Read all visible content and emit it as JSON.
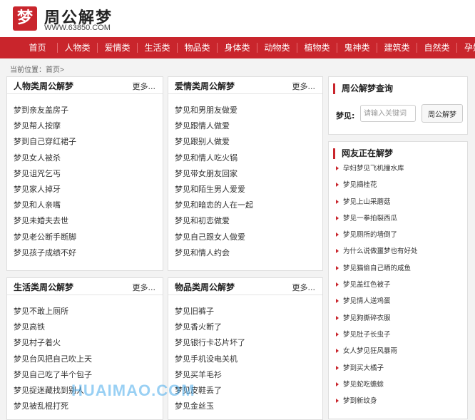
{
  "site": {
    "logo_char": "梦",
    "title": "周公解梦",
    "url": "WWW.63850.COM"
  },
  "nav": [
    "首页",
    "人物类",
    "爱情类",
    "生活类",
    "物品类",
    "身体类",
    "动物类",
    "植物类",
    "鬼神类",
    "建筑类",
    "自然类",
    "孕妇类"
  ],
  "breadcrumb": {
    "label": "当前位置：",
    "home": "首页",
    "sep": ">"
  },
  "boxes": [
    {
      "title": "人物类周公解梦",
      "more": "更多...",
      "items": [
        "梦到亲友盖房子",
        "梦见帮人按摩",
        "梦到自己穿红裙子",
        "梦见女人被杀",
        "梦见诅咒乞丐",
        "梦见家人掉牙",
        "梦见和人亲嘴",
        "梦见未婚夫去世",
        "梦见老公断手断脚",
        "梦见孩子成绩不好"
      ]
    },
    {
      "title": "爱情类周公解梦",
      "more": "更多...",
      "items": [
        "梦见和男朋友做爱",
        "梦见跟情人做爱",
        "梦见跟别人做爱",
        "梦见和情人吃火锅",
        "梦见带女朋友回家",
        "梦见和陌生男人爱爱",
        "梦见和暗恋的人在一起",
        "梦见和初恋做爱",
        "梦见自己跟女人做爱",
        "梦见和情人约会"
      ]
    },
    {
      "title": "生活类周公解梦",
      "more": "更多...",
      "items": [
        "梦见不敢上厕所",
        "梦见高铁",
        "梦见村子着火",
        "梦见台风把自己吹上天",
        "梦见自己吃了半个包子",
        "梦见捉迷藏找到别人",
        "梦见被乱棍打死"
      ]
    },
    {
      "title": "物品类周公解梦",
      "more": "更多...",
      "items": [
        "梦见旧裤子",
        "梦见香火断了",
        "梦见银行卡芯片坏了",
        "梦见手机没电关机",
        "梦见买羊毛衫",
        "梦见皮鞋丢了",
        "梦见金丝玉"
      ]
    }
  ],
  "search": {
    "title": "周公解梦查询",
    "label": "梦见:",
    "placeholder": "请输入关键词",
    "button": "周公解梦"
  },
  "hot": {
    "title": "网友正在解梦",
    "items": [
      "孕妇梦见飞机撞水库",
      "梦见摘桂花",
      "梦见上山采蘑菇",
      "梦见一拳拍裂西瓜",
      "梦见厕所的墙倒了",
      "为什么说做噩梦也有好处",
      "梦见猫偷自己晒的咸鱼",
      "梦见盖红色被子",
      "梦见情人送鸡蛋",
      "梦见狗撕碎衣服",
      "梦见肚子长虫子",
      "女人梦见狂风暴雨",
      "梦到买大橘子",
      "梦见蛇吃蟾蜍",
      "梦到新纹身"
    ]
  },
  "watermark": "HUAIMAO.COM",
  "colors": {
    "brand": "#c9252c",
    "background": "#f3f3f3"
  }
}
